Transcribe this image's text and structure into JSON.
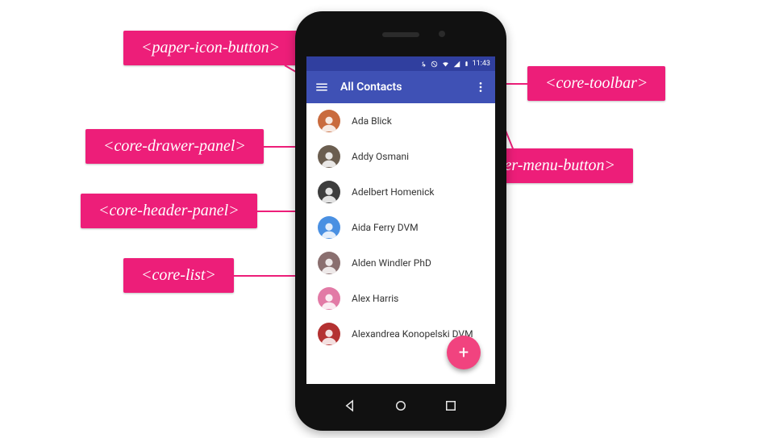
{
  "callouts": {
    "paper_icon_button": "<paper-icon-button>",
    "core_drawer_panel": "<core-drawer-panel>",
    "core_header_panel": "<core-header-panel>",
    "core_list": "<core-list>",
    "core_toolbar": "<core-toolbar>",
    "paper_menu_button": "<paper-menu-button>"
  },
  "statusbar": {
    "time": "11:43",
    "icons": [
      "bluetooth",
      "do-not-disturb",
      "wifi",
      "signal",
      "battery"
    ]
  },
  "toolbar": {
    "title": "All Contacts",
    "menu_icon": "hamburger-icon",
    "overflow_icon": "more-vert-icon"
  },
  "contacts": [
    {
      "name": "Ada Blick",
      "avatar_bg": "#c96b3e"
    },
    {
      "name": "Addy Osmani",
      "avatar_bg": "#6b5e50"
    },
    {
      "name": "Adelbert Homenick",
      "avatar_bg": "#3d3d3d"
    },
    {
      "name": "Aida Ferry DVM",
      "avatar_bg": "#4a90e2"
    },
    {
      "name": "Alden Windler PhD",
      "avatar_bg": "#8a6f6f"
    },
    {
      "name": "Alex Harris",
      "avatar_bg": "#e27aa6"
    },
    {
      "name": "Alexandrea Konopelski DVM",
      "avatar_bg": "#b43131"
    }
  ],
  "fab": {
    "label": "+",
    "icon": "add-icon"
  },
  "nav": {
    "back": "back-icon",
    "home": "home-icon",
    "recent": "recent-icon"
  },
  "colors": {
    "accent": "#ed1e79",
    "toolbar": "#3f51b5",
    "statusbar": "#303f9f",
    "fab": "#f1437f"
  }
}
